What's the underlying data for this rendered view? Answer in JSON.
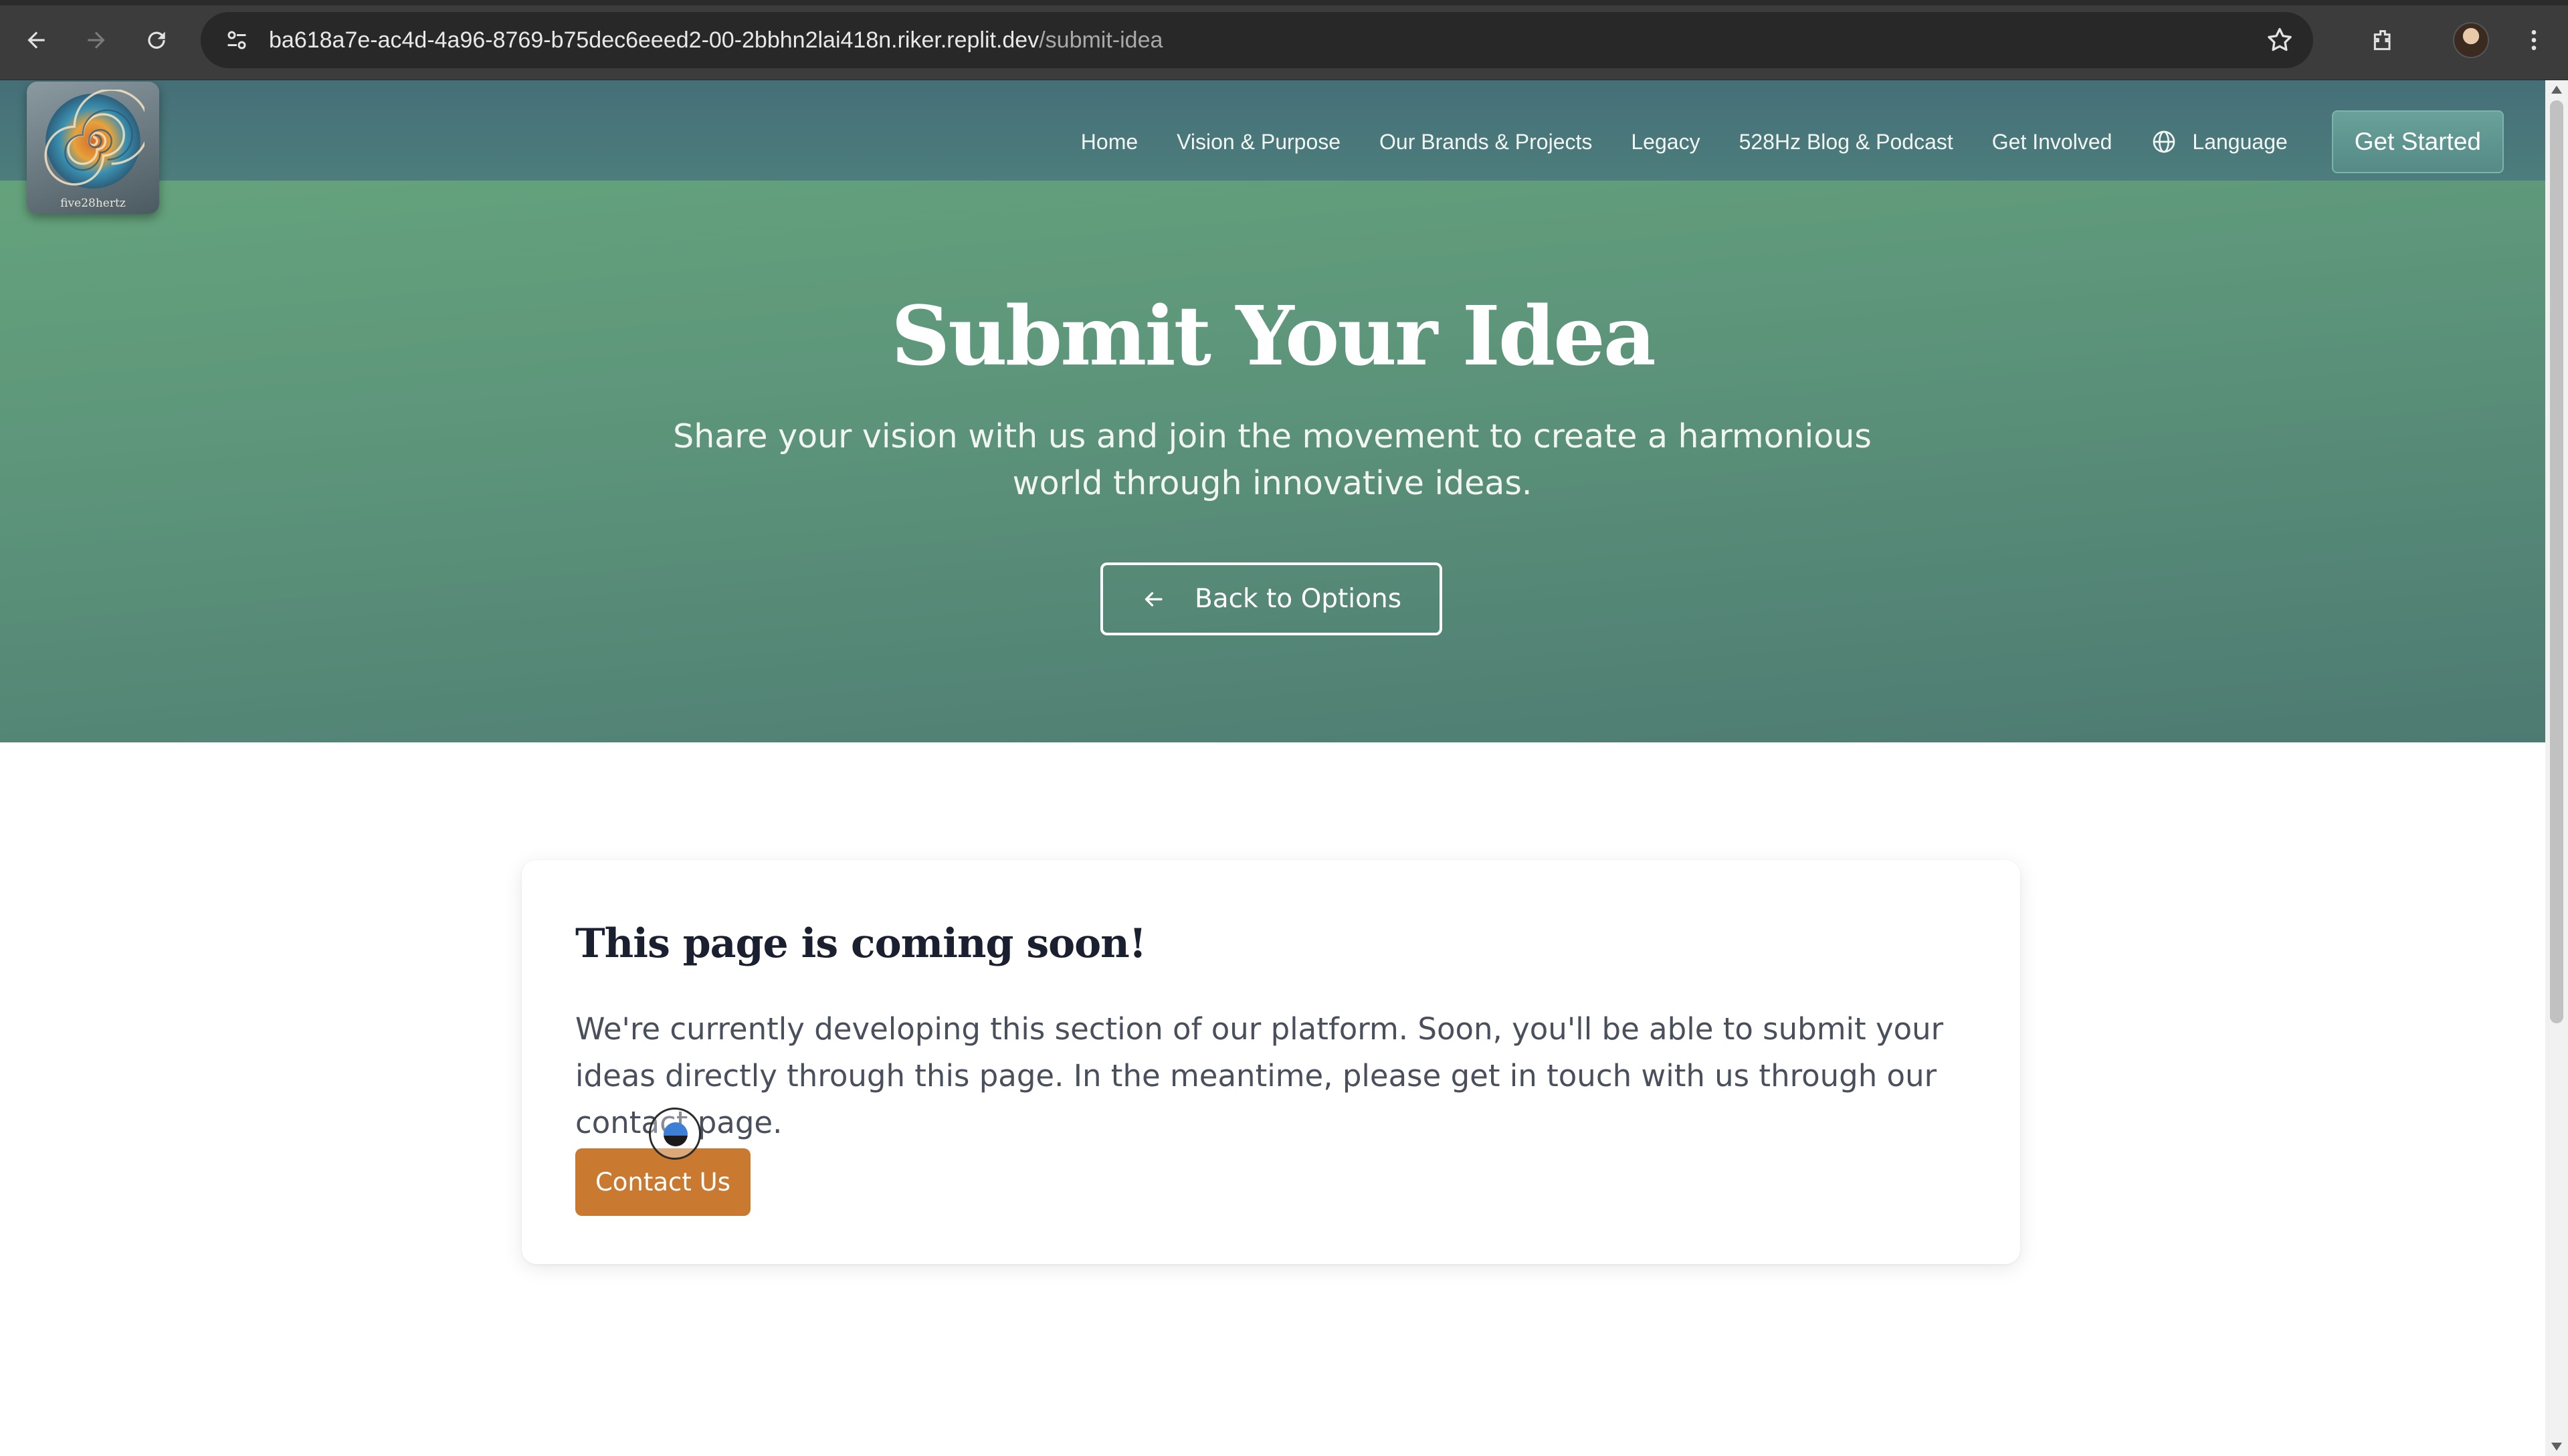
{
  "browser": {
    "url_host": "ba618a7e-ac4d-4a96-8769-b75dec6eeed2-00-2bbhn2lai418n.riker.replit.dev",
    "url_path": "/submit-idea",
    "icons": [
      "back-icon",
      "forward-icon",
      "reload-icon",
      "site-settings-icon",
      "bookmark-star-icon",
      "extensions-icon",
      "profile-avatar",
      "menu-icon"
    ]
  },
  "header": {
    "logo_text": "five28hertz",
    "nav": [
      "Home",
      "Vision & Purpose",
      "Our Brands & Projects",
      "Legacy",
      "528Hz Blog & Podcast",
      "Get Involved"
    ],
    "language_label": "Language",
    "cta_label": "Get Started"
  },
  "hero": {
    "title": "Submit Your Idea",
    "subtitle": "Share your vision with us and join the movement to create a harmonious world through innovative ideas.",
    "back_button_label": "Back to Options"
  },
  "card": {
    "title": "This page is coming soon!",
    "body": "We're currently developing this section of our platform. Soon, you'll be able to submit your ideas directly through this page. In the meantime, please get in touch with us through our contact page.",
    "button_label": "Contact Us"
  },
  "colors": {
    "hero_top": "#67a77c",
    "hero_bottom": "#4d7a72",
    "header": "#456f78",
    "contact_button": "#c97a30",
    "title_text": "#1b2030"
  }
}
